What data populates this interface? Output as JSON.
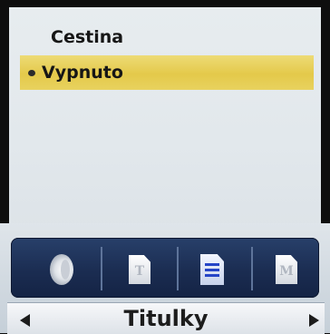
{
  "subtitle_menu": {
    "options": [
      {
        "label": "Cestina",
        "selected": false
      },
      {
        "label": "Vypnuto",
        "selected": true
      }
    ]
  },
  "category_bar": {
    "icons": [
      "speaker-audio-icon",
      "text-document-icon",
      "subtitles-document-icon",
      "menu-document-icon"
    ],
    "active_index": 2
  },
  "footer": {
    "title": "Titulky"
  },
  "colors": {
    "selection": "#e4c94a",
    "icon_bar": "#1b2d52",
    "panel": "#e3e9ed"
  }
}
